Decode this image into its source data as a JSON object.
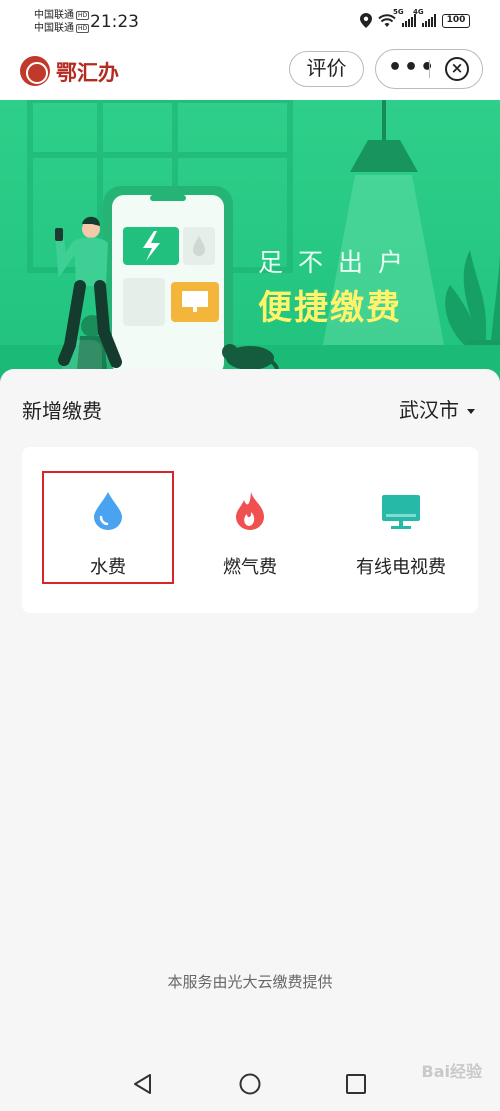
{
  "status_bar": {
    "carrier_1": "中国联通",
    "carrier_2": "中国联通",
    "hd": "HD",
    "time": "21:23",
    "network_1": "5G",
    "network_2": "4G",
    "battery": "100"
  },
  "header": {
    "app_title": "鄂汇办",
    "rate_label": "评价",
    "more_label": "•••",
    "close_label": "×"
  },
  "banner": {
    "slogan_line1": "足不出户",
    "slogan_line2": "便捷缴费"
  },
  "section": {
    "title": "新增缴费",
    "city": "武汉市"
  },
  "services": [
    {
      "label": "水费",
      "icon": "water-drop-icon",
      "color": "#4aa3f0",
      "selected": true
    },
    {
      "label": "燃气费",
      "icon": "flame-icon",
      "color": "#f05050"
    },
    {
      "label": "有线电视费",
      "icon": "tv-icon",
      "color": "#27b9a8"
    }
  ],
  "footer": {
    "provider": "本服务由光大云缴费提供"
  },
  "watermark": "Bai经验",
  "colors": {
    "banner_green": "#2ecf8a",
    "slogan_yellow": "#fff36b",
    "brand_red": "#b52b21",
    "highlight_red": "#d8252a"
  }
}
